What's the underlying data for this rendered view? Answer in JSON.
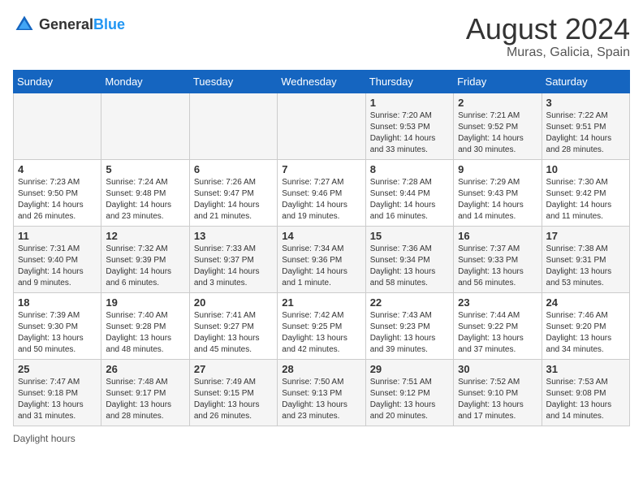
{
  "header": {
    "logo_general": "General",
    "logo_blue": "Blue",
    "main_title": "August 2024",
    "subtitle": "Muras, Galicia, Spain"
  },
  "days_of_week": [
    "Sunday",
    "Monday",
    "Tuesday",
    "Wednesday",
    "Thursday",
    "Friday",
    "Saturday"
  ],
  "weeks": [
    [
      {
        "day": "",
        "info": ""
      },
      {
        "day": "",
        "info": ""
      },
      {
        "day": "",
        "info": ""
      },
      {
        "day": "",
        "info": ""
      },
      {
        "day": "1",
        "info": "Sunrise: 7:20 AM\nSunset: 9:53 PM\nDaylight: 14 hours and 33 minutes."
      },
      {
        "day": "2",
        "info": "Sunrise: 7:21 AM\nSunset: 9:52 PM\nDaylight: 14 hours and 30 minutes."
      },
      {
        "day": "3",
        "info": "Sunrise: 7:22 AM\nSunset: 9:51 PM\nDaylight: 14 hours and 28 minutes."
      }
    ],
    [
      {
        "day": "4",
        "info": "Sunrise: 7:23 AM\nSunset: 9:50 PM\nDaylight: 14 hours and 26 minutes."
      },
      {
        "day": "5",
        "info": "Sunrise: 7:24 AM\nSunset: 9:48 PM\nDaylight: 14 hours and 23 minutes."
      },
      {
        "day": "6",
        "info": "Sunrise: 7:26 AM\nSunset: 9:47 PM\nDaylight: 14 hours and 21 minutes."
      },
      {
        "day": "7",
        "info": "Sunrise: 7:27 AM\nSunset: 9:46 PM\nDaylight: 14 hours and 19 minutes."
      },
      {
        "day": "8",
        "info": "Sunrise: 7:28 AM\nSunset: 9:44 PM\nDaylight: 14 hours and 16 minutes."
      },
      {
        "day": "9",
        "info": "Sunrise: 7:29 AM\nSunset: 9:43 PM\nDaylight: 14 hours and 14 minutes."
      },
      {
        "day": "10",
        "info": "Sunrise: 7:30 AM\nSunset: 9:42 PM\nDaylight: 14 hours and 11 minutes."
      }
    ],
    [
      {
        "day": "11",
        "info": "Sunrise: 7:31 AM\nSunset: 9:40 PM\nDaylight: 14 hours and 9 minutes."
      },
      {
        "day": "12",
        "info": "Sunrise: 7:32 AM\nSunset: 9:39 PM\nDaylight: 14 hours and 6 minutes."
      },
      {
        "day": "13",
        "info": "Sunrise: 7:33 AM\nSunset: 9:37 PM\nDaylight: 14 hours and 3 minutes."
      },
      {
        "day": "14",
        "info": "Sunrise: 7:34 AM\nSunset: 9:36 PM\nDaylight: 14 hours and 1 minute."
      },
      {
        "day": "15",
        "info": "Sunrise: 7:36 AM\nSunset: 9:34 PM\nDaylight: 13 hours and 58 minutes."
      },
      {
        "day": "16",
        "info": "Sunrise: 7:37 AM\nSunset: 9:33 PM\nDaylight: 13 hours and 56 minutes."
      },
      {
        "day": "17",
        "info": "Sunrise: 7:38 AM\nSunset: 9:31 PM\nDaylight: 13 hours and 53 minutes."
      }
    ],
    [
      {
        "day": "18",
        "info": "Sunrise: 7:39 AM\nSunset: 9:30 PM\nDaylight: 13 hours and 50 minutes."
      },
      {
        "day": "19",
        "info": "Sunrise: 7:40 AM\nSunset: 9:28 PM\nDaylight: 13 hours and 48 minutes."
      },
      {
        "day": "20",
        "info": "Sunrise: 7:41 AM\nSunset: 9:27 PM\nDaylight: 13 hours and 45 minutes."
      },
      {
        "day": "21",
        "info": "Sunrise: 7:42 AM\nSunset: 9:25 PM\nDaylight: 13 hours and 42 minutes."
      },
      {
        "day": "22",
        "info": "Sunrise: 7:43 AM\nSunset: 9:23 PM\nDaylight: 13 hours and 39 minutes."
      },
      {
        "day": "23",
        "info": "Sunrise: 7:44 AM\nSunset: 9:22 PM\nDaylight: 13 hours and 37 minutes."
      },
      {
        "day": "24",
        "info": "Sunrise: 7:46 AM\nSunset: 9:20 PM\nDaylight: 13 hours and 34 minutes."
      }
    ],
    [
      {
        "day": "25",
        "info": "Sunrise: 7:47 AM\nSunset: 9:18 PM\nDaylight: 13 hours and 31 minutes."
      },
      {
        "day": "26",
        "info": "Sunrise: 7:48 AM\nSunset: 9:17 PM\nDaylight: 13 hours and 28 minutes."
      },
      {
        "day": "27",
        "info": "Sunrise: 7:49 AM\nSunset: 9:15 PM\nDaylight: 13 hours and 26 minutes."
      },
      {
        "day": "28",
        "info": "Sunrise: 7:50 AM\nSunset: 9:13 PM\nDaylight: 13 hours and 23 minutes."
      },
      {
        "day": "29",
        "info": "Sunrise: 7:51 AM\nSunset: 9:12 PM\nDaylight: 13 hours and 20 minutes."
      },
      {
        "day": "30",
        "info": "Sunrise: 7:52 AM\nSunset: 9:10 PM\nDaylight: 13 hours and 17 minutes."
      },
      {
        "day": "31",
        "info": "Sunrise: 7:53 AM\nSunset: 9:08 PM\nDaylight: 13 hours and 14 minutes."
      }
    ]
  ],
  "footer": {
    "note": "Daylight hours"
  }
}
